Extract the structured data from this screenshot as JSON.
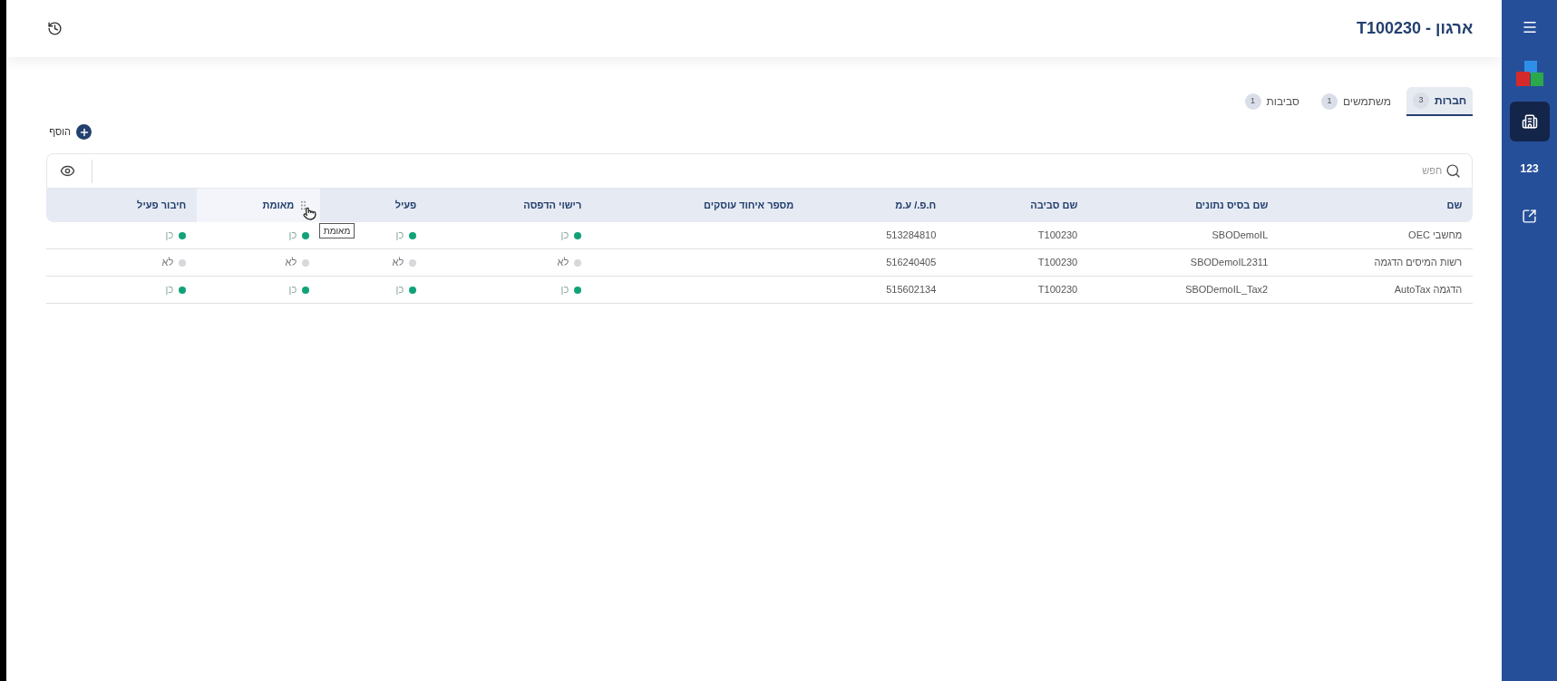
{
  "sidebar": {
    "items": [
      {
        "kind": "menu",
        "selected": false
      },
      {
        "kind": "logo",
        "selected": false
      },
      {
        "kind": "building",
        "selected": true
      },
      {
        "kind": "text",
        "label": "123",
        "selected": false
      },
      {
        "kind": "external",
        "selected": false
      }
    ]
  },
  "header": {
    "title": "ארגון - T100230"
  },
  "tabs": [
    {
      "label": "חברות",
      "count": "3",
      "selected": true
    },
    {
      "label": "משתמשים",
      "count": "1",
      "selected": false
    },
    {
      "label": "סביבות",
      "count": "1",
      "selected": false
    }
  ],
  "add_button": {
    "label": "הוסף"
  },
  "search": {
    "placeholder": "חפש"
  },
  "table": {
    "columns": [
      {
        "label": "שם",
        "highlighted": false
      },
      {
        "label": "שם בסיס נתונים",
        "highlighted": false
      },
      {
        "label": "שם סביבה",
        "highlighted": false
      },
      {
        "label": "ח.פ./ ע.מ",
        "highlighted": false
      },
      {
        "label": "מספר איחוד עוסקים",
        "highlighted": false
      },
      {
        "label": "רישוי הדפסה",
        "highlighted": false
      },
      {
        "label": "פעיל",
        "highlighted": false
      },
      {
        "label": "מאומת",
        "highlighted": true,
        "tooltip": "מאומת"
      },
      {
        "label": "חיבור פעיל",
        "highlighted": false
      }
    ],
    "rows": [
      {
        "cells": [
          {
            "kind": "text",
            "text": "מחשבי OEC"
          },
          {
            "kind": "text",
            "text": "SBODemoIL"
          },
          {
            "kind": "text",
            "text": "T100230"
          },
          {
            "kind": "text",
            "text": "513284810"
          },
          {
            "kind": "empty"
          },
          {
            "kind": "status",
            "text": "כן",
            "on": true
          },
          {
            "kind": "status",
            "text": "כן",
            "on": true
          },
          {
            "kind": "status",
            "text": "כן",
            "on": true
          },
          {
            "kind": "status",
            "text": "כן",
            "on": true
          }
        ]
      },
      {
        "cells": [
          {
            "kind": "text",
            "text": "רשות המיסים הדגמה"
          },
          {
            "kind": "text",
            "text": "SBODemoIL2311"
          },
          {
            "kind": "text",
            "text": "T100230"
          },
          {
            "kind": "text",
            "text": "516240405"
          },
          {
            "kind": "empty"
          },
          {
            "kind": "status",
            "text": "לא",
            "on": false
          },
          {
            "kind": "status",
            "text": "לא",
            "on": false
          },
          {
            "kind": "status",
            "text": "לא",
            "on": false
          },
          {
            "kind": "status",
            "text": "לא",
            "on": false
          }
        ]
      },
      {
        "cells": [
          {
            "kind": "text",
            "text": "הדגמה AutoTax"
          },
          {
            "kind": "text",
            "text": "SBODemoIL_Tax2"
          },
          {
            "kind": "text",
            "text": "T100230"
          },
          {
            "kind": "text",
            "text": "515602134"
          },
          {
            "kind": "empty"
          },
          {
            "kind": "status",
            "text": "כן",
            "on": true
          },
          {
            "kind": "status",
            "text": "כן",
            "on": true
          },
          {
            "kind": "status",
            "text": "כן",
            "on": true
          },
          {
            "kind": "status",
            "text": "כן",
            "on": true
          }
        ]
      }
    ]
  }
}
